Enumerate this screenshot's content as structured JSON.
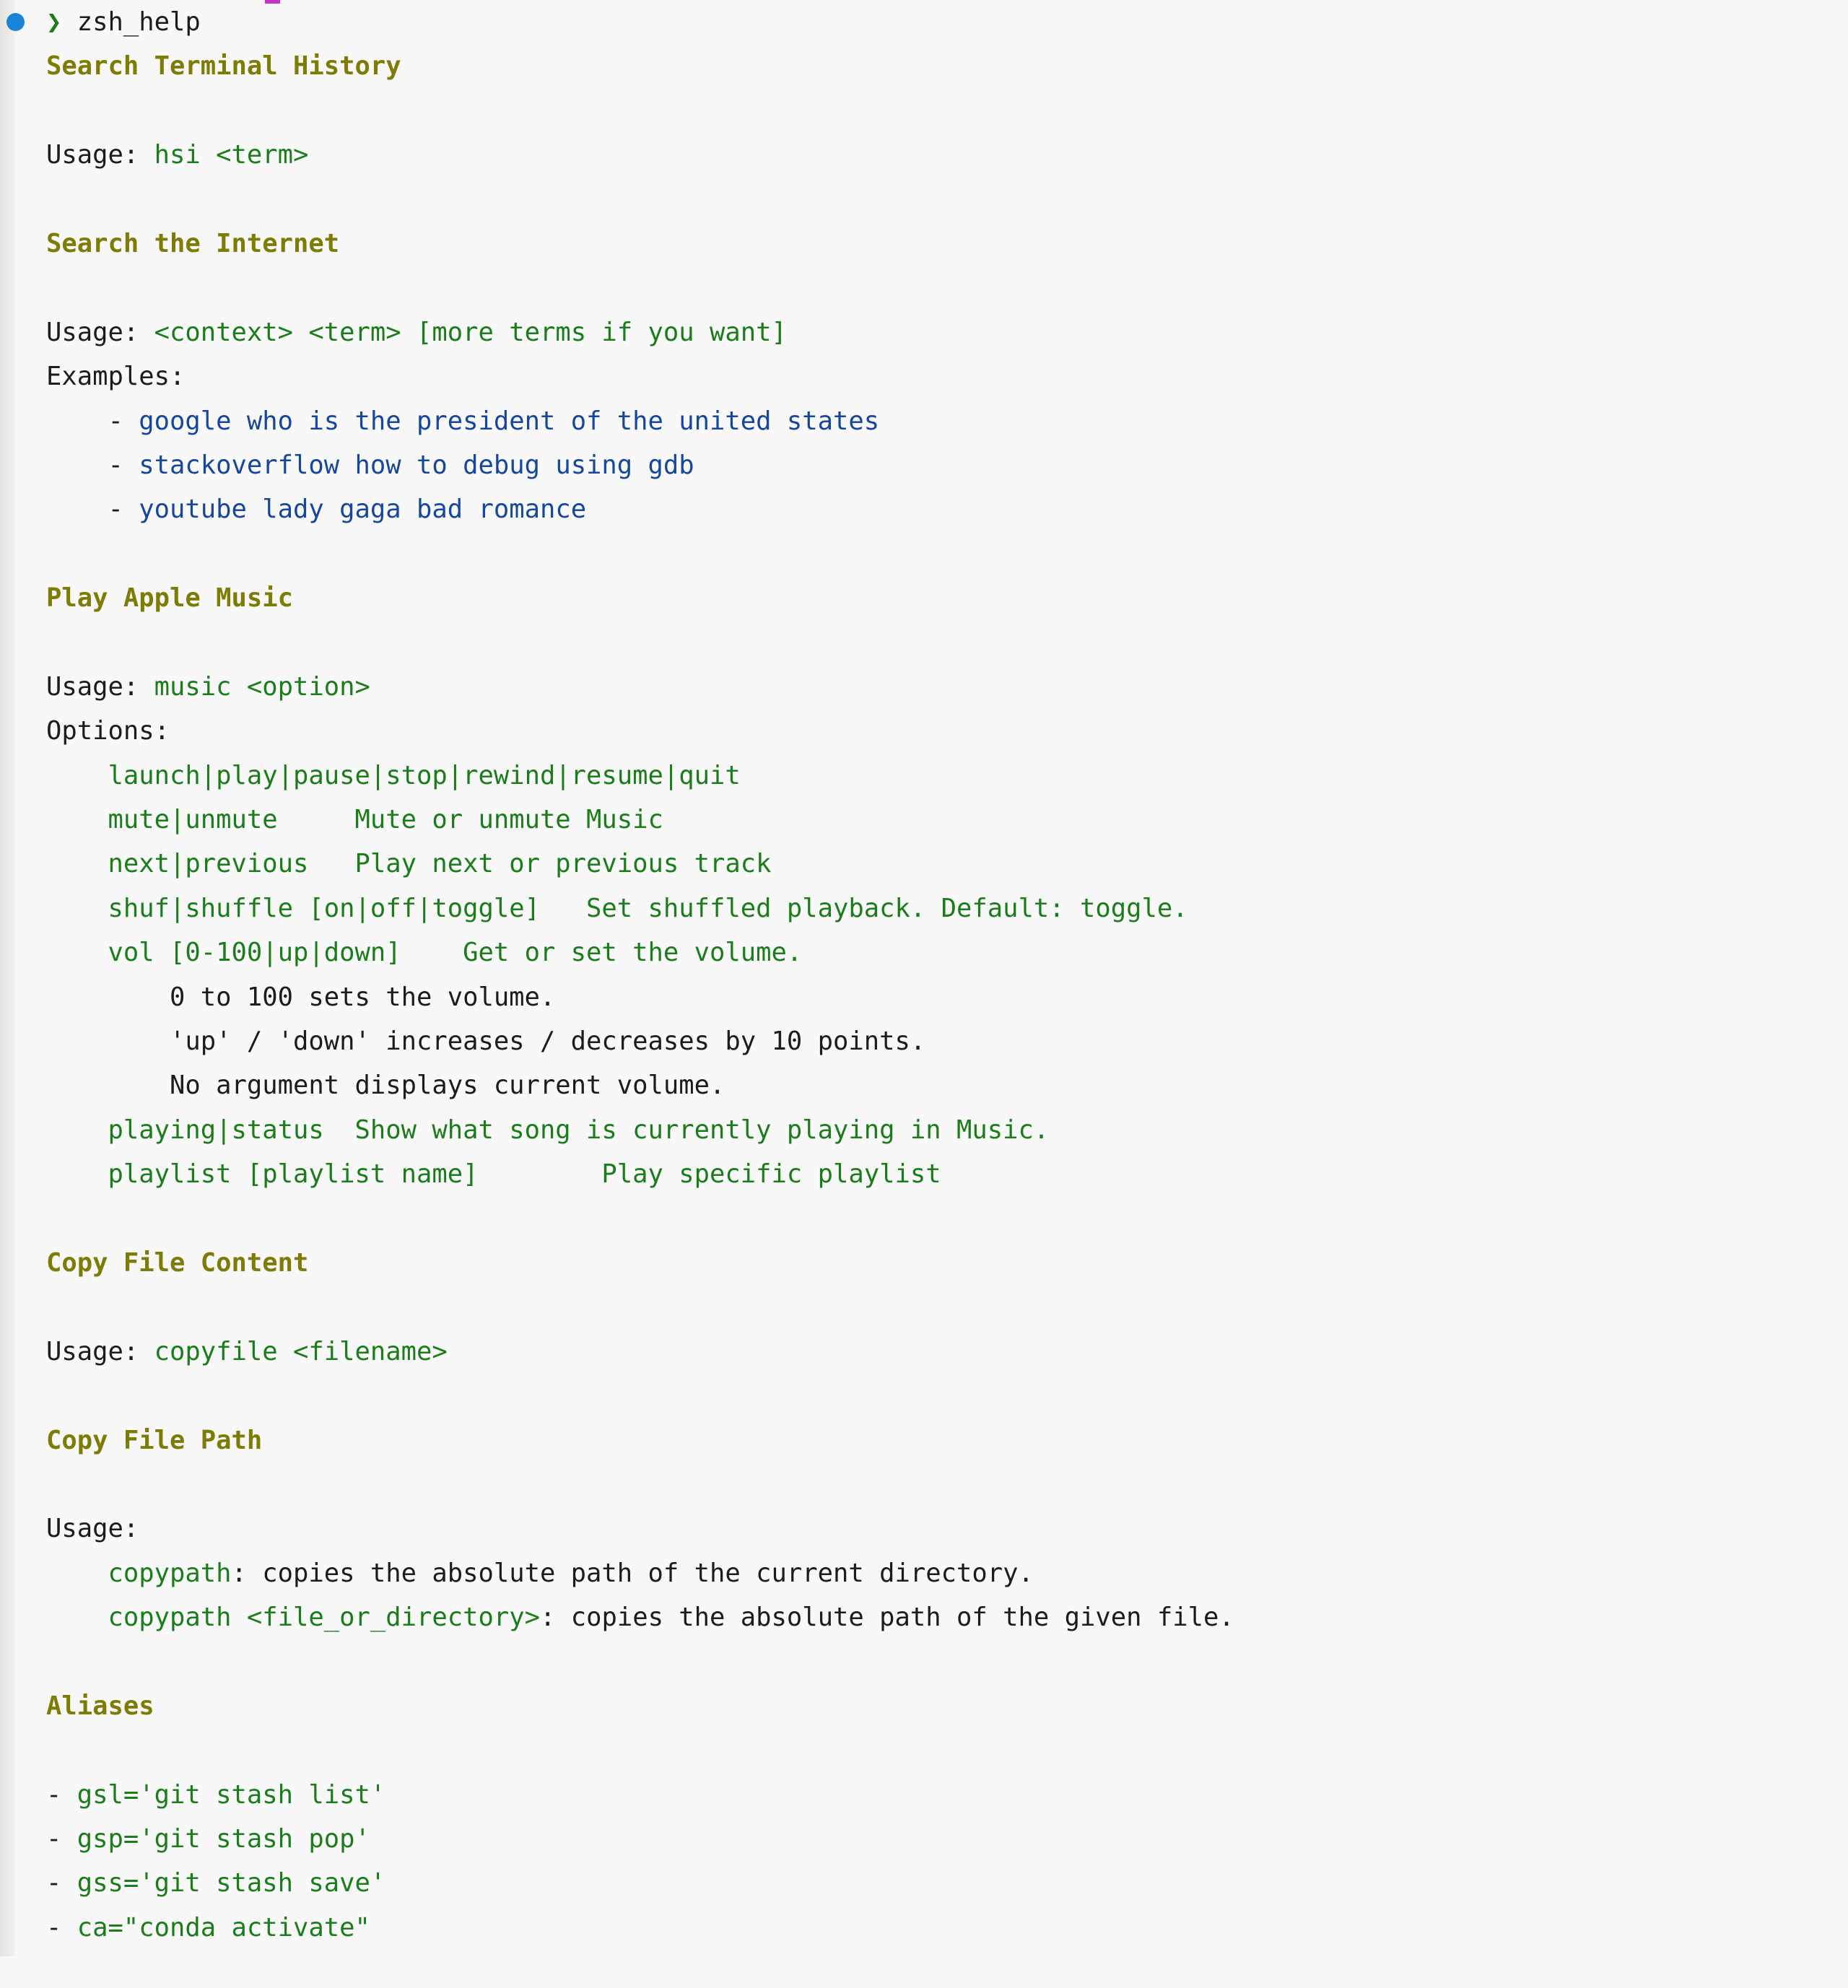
{
  "terminal": {
    "prompt_symbol": "❯",
    "command": "zsh_help",
    "bullet_color": "#1a85d6",
    "prompt_color": "#1a7d1a",
    "background": "#f8f8f9",
    "colors": {
      "heading": "#7f7c06",
      "green": "#1a7d1a",
      "blue": "#16479c",
      "text": "#1c1c1c",
      "gutter": "#e8e8e8",
      "magenta": "#c832c8"
    }
  },
  "sections": [
    {
      "heading": "Search Terminal History",
      "lines": [
        {
          "label": "Usage: ",
          "code": "hsi <term>"
        }
      ]
    },
    {
      "heading": "Search the Internet",
      "usage_label": "Usage: ",
      "usage_code": "<context> <term> [more terms if you want]",
      "examples_label": "Examples:",
      "examples": [
        "google who is the president of the united states",
        "stackoverflow how to debug using gdb",
        "youtube lady gaga bad romance"
      ]
    },
    {
      "heading": "Play Apple Music",
      "usage_label": "Usage: ",
      "usage_code": "music <option>",
      "options_label": "Options:",
      "options": [
        "launch|play|pause|stop|rewind|resume|quit",
        "mute|unmute     Mute or unmute Music",
        "next|previous   Play next or previous track",
        "shuf|shuffle [on|off|toggle]   Set shuffled playback. Default: toggle.",
        "vol [0-100|up|down]    Get or set the volume."
      ],
      "vol_notes": [
        "0 to 100 sets the volume.",
        "'up' / 'down' increases / decreases by 10 points.",
        "No argument displays current volume."
      ],
      "options_tail": [
        "playing|status  Show what song is currently playing in Music.",
        "playlist [playlist name]        Play specific playlist"
      ]
    },
    {
      "heading": "Copy File Content",
      "usage_label": "Usage: ",
      "usage_code": "copyfile <filename>"
    },
    {
      "heading": "Copy File Path",
      "usage_label": "Usage:",
      "paths": [
        {
          "cmd": "copypath",
          "rest": ": copies the absolute path of the current directory."
        },
        {
          "cmd": "copypath <file_or_directory>",
          "rest": ": copies the absolute path of the given file."
        }
      ]
    },
    {
      "heading": "Aliases",
      "aliases": [
        "gsl='git stash list'",
        "gsp='git stash pop'",
        "gss='git stash save'",
        "ca=\"conda activate\""
      ],
      "dash": "- "
    }
  ],
  "labels": {
    "dash_bullet": "- ",
    "indent4": "    ",
    "indent8": "        "
  }
}
